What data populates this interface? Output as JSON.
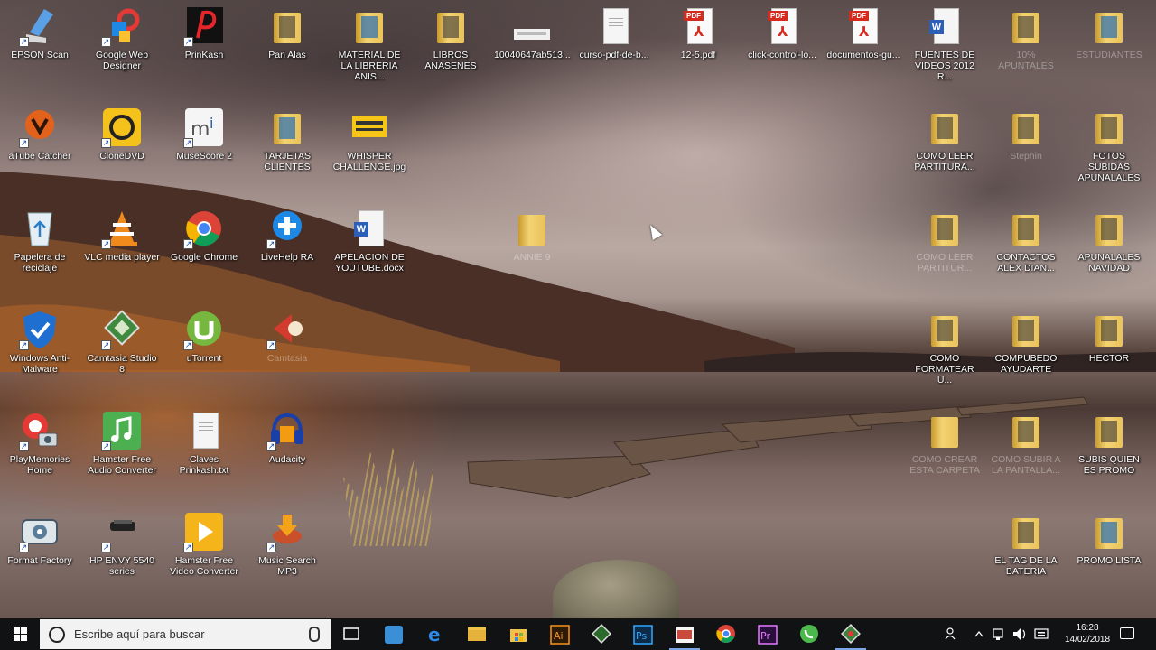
{
  "desktop": {
    "icons": [
      {
        "label": "EPSON Scan",
        "type": "epson"
      },
      {
        "label": "Google Web Designer",
        "type": "gwd"
      },
      {
        "label": "PrinKash",
        "type": "prinkash"
      },
      {
        "label": "Pan Alas",
        "type": "folder"
      },
      {
        "label": "MATERIAL DE LA LIBRERIA ANIS...",
        "type": "folder"
      },
      {
        "label": "LIBROS ANASENES",
        "type": "folder"
      },
      {
        "label": "10040647ab513...",
        "type": "image"
      },
      {
        "label": "curso-pdf-de-b...",
        "type": "doc"
      },
      {
        "label": "12-5.pdf",
        "type": "pdf"
      },
      {
        "label": "click-control-lo...",
        "type": "pdf"
      },
      {
        "label": "documentos-gu...",
        "type": "pdf"
      },
      {
        "label": "FUENTES DE VIDEOS 2012 R...",
        "type": "word"
      },
      {
        "label": "10% APUNTALES",
        "type": "folder"
      },
      {
        "label": "ESTUDIANTES",
        "type": "folder"
      },
      {
        "label": "aTube Catcher",
        "type": "atube"
      },
      {
        "label": "CloneDVD",
        "type": "clonedvd"
      },
      {
        "label": "MuseScore 2",
        "type": "muse"
      },
      {
        "label": "TARJETAS CLIENTES",
        "type": "folder"
      },
      {
        "label": "WHISPER CHALLENGE.jpg",
        "type": "whisper"
      },
      {
        "label": "COMO LEER PARTITURA...",
        "type": "folder"
      },
      {
        "label": "Stephin",
        "type": "folder"
      },
      {
        "label": "FOTOS SUBIDAS APUNALALES",
        "type": "folder"
      },
      {
        "label": "Papelera de reciclaje",
        "type": "recycle"
      },
      {
        "label": "VLC media player",
        "type": "vlc"
      },
      {
        "label": "Google Chrome",
        "type": "chrome"
      },
      {
        "label": "LiveHelp RA",
        "type": "livehelp"
      },
      {
        "label": "APELACION DE YOUTUBE.docx",
        "type": "word"
      },
      {
        "label": "ANNIE 9",
        "type": "folder-plain"
      },
      {
        "label": "COMO LEER PARTITUR...",
        "type": "folder"
      },
      {
        "label": "CONTACTOS ALEX DIAN...",
        "type": "folder"
      },
      {
        "label": "APUNALALES NAVIDAD",
        "type": "folder"
      },
      {
        "label": "Windows Anti-Malware",
        "type": "shield"
      },
      {
        "label": "Camtasia Studio 8",
        "type": "camtasia"
      },
      {
        "label": "uTorrent",
        "type": "utorrent"
      },
      {
        "label": "Camtasia",
        "type": "camrec"
      },
      {
        "label": "COMO FORMATEAR U...",
        "type": "folder"
      },
      {
        "label": "COMPUBEDO AYUDARTE",
        "type": "folder"
      },
      {
        "label": "HECTOR",
        "type": "folder"
      },
      {
        "label": "PlayMemories Home",
        "type": "playmem"
      },
      {
        "label": "Hamster Free Audio Converter",
        "type": "hamster-audio"
      },
      {
        "label": "Claves Prinkash.txt",
        "type": "txt"
      },
      {
        "label": "Audacity",
        "type": "audacity"
      },
      {
        "label": "COMO CREAR ESTA CARPETA",
        "type": "folder-plain"
      },
      {
        "label": "COMO SUBIR A LA PANTALLA...",
        "type": "folder"
      },
      {
        "label": "SUBIS QUIEN ES PROMO",
        "type": "folder"
      },
      {
        "label": "Format Factory",
        "type": "formatfactory"
      },
      {
        "label": "HP ENVY 5540 series",
        "type": "hp"
      },
      {
        "label": "Hamster Free Video Converter",
        "type": "hamster-video"
      },
      {
        "label": "Music Search MP3",
        "type": "musicsearch"
      },
      {
        "label": "EL TAG DE LA BATERIA",
        "type": "folder"
      },
      {
        "label": "PROMO LISTA",
        "type": "folder-blue"
      }
    ]
  },
  "taskbar": {
    "search_placeholder": "Escribe aquí para buscar",
    "apps": [
      {
        "name": "task-view",
        "color": "#101214"
      },
      {
        "name": "calculator",
        "color": "#3b8fd6"
      },
      {
        "name": "edge",
        "color": "#1e73d6"
      },
      {
        "name": "file-explorer",
        "color": "#f0c24a"
      },
      {
        "name": "store",
        "color": "#f0c24a"
      },
      {
        "name": "illustrator",
        "color": "#2d1a07"
      },
      {
        "name": "camtasia",
        "color": "#2a6a2a"
      },
      {
        "name": "photoshop",
        "color": "#0d2a47"
      },
      {
        "name": "app-image",
        "color": "#c84a3a"
      },
      {
        "name": "chrome",
        "color": "#e8b430"
      },
      {
        "name": "premiere",
        "color": "#2a0f3d"
      },
      {
        "name": "whatsapp",
        "color": "#4cb94c"
      },
      {
        "name": "camtasia-recorder",
        "color": "#3f7f3f"
      }
    ],
    "time": "16:28",
    "date": "14/02/2018"
  }
}
